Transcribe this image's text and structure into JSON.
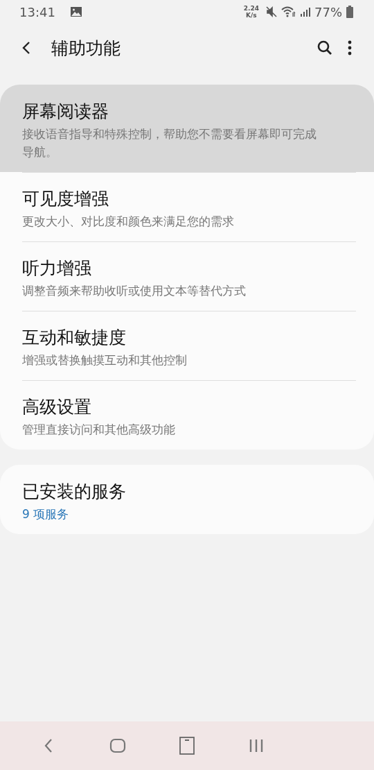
{
  "status_bar": {
    "time": "13:41",
    "speed_value": "2.24",
    "speed_unit": "K/s",
    "battery": "77%"
  },
  "header": {
    "title": "辅助功能"
  },
  "groups": [
    {
      "items": [
        {
          "title": "屏幕阅读器",
          "subtitle": "接收语音指导和特殊控制，帮助您不需要看屏幕即可完成导航。",
          "selected": true
        },
        {
          "title": "可见度增强",
          "subtitle": "更改大小、对比度和颜色来满足您的需求",
          "selected": false
        },
        {
          "title": "听力增强",
          "subtitle": "调整音频来帮助收听或使用文本等替代方式",
          "selected": false
        },
        {
          "title": "互动和敏捷度",
          "subtitle": "增强或替换触摸互动和其他控制",
          "selected": false
        },
        {
          "title": "高级设置",
          "subtitle": "管理直接访问和其他高级功能",
          "selected": false
        }
      ]
    },
    {
      "items": [
        {
          "title": "已安装的服务",
          "subtitle": "9 项服务",
          "kind": "link",
          "selected": false
        }
      ]
    }
  ]
}
